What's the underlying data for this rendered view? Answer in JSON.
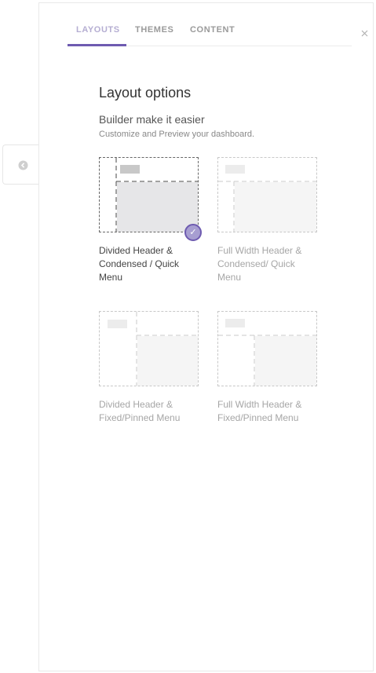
{
  "tabs": [
    {
      "label": "LAYOUTS"
    },
    {
      "label": "THEMES"
    },
    {
      "label": "CONTENT"
    }
  ],
  "close_label": "×",
  "title": "Layout options",
  "subtitle": "Builder make it easier",
  "description": "Customize and Preview your dashboard.",
  "options": [
    {
      "label": "Divided Header & Condensed / Quick Menu",
      "selected": true
    },
    {
      "label": "Full Width Header & Condensed/ Quick Menu",
      "selected": false
    },
    {
      "label": "Divided Header & Fixed/Pinned Menu",
      "selected": false
    },
    {
      "label": "Full Width Header & Fixed/Pinned Menu",
      "selected": false
    }
  ],
  "check_glyph": "✓",
  "colors": {
    "accent": "#6e5bb0",
    "accent_light": "#a79ed1"
  }
}
